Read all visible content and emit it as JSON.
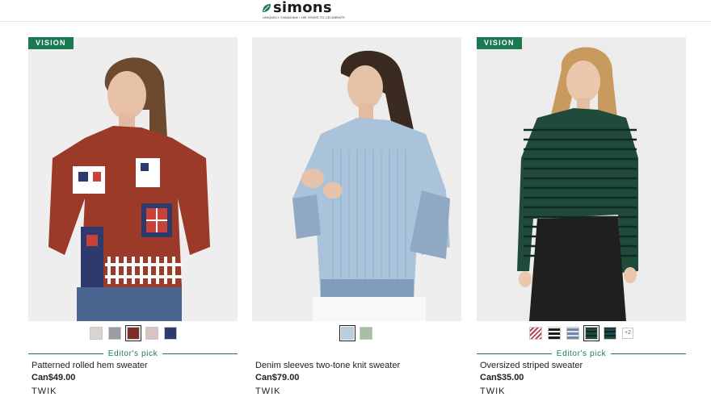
{
  "header": {
    "logo_text": "simons",
    "logo_tagline": "UNIQUELY CANADIAN • 185 YEARS TO CELEBRATE"
  },
  "products": [
    {
      "badge": "VISION",
      "name": "Patterned rolled hem sweater",
      "price": "Can$49.00",
      "brand": "TWIK",
      "editor_pick": "Editor's pick",
      "swatches": [
        "#d9d4cf",
        "#9a9ea4",
        "#7a2f24",
        "#d8c3c0",
        "#2e3a6e"
      ],
      "selected_swatch": 2
    },
    {
      "badge": "",
      "name": "Denim sleeves two-tone knit sweater",
      "price": "Can$79.00",
      "brand": "TWIK",
      "editor_pick": "",
      "swatches": [
        "#b7cde0",
        "#a6bfa6"
      ],
      "selected_swatch": 0
    },
    {
      "badge": "VISION",
      "name": "Oversized striped sweater",
      "price": "Can$35.00",
      "brand": "TWIK",
      "editor_pick": "Editor's pick",
      "swatches": [
        "#b64655",
        "#1d1d1d",
        "#7088a8",
        "#24493b",
        "#1f4a4a"
      ],
      "selected_swatch": 3,
      "more_colors": "+2"
    }
  ]
}
